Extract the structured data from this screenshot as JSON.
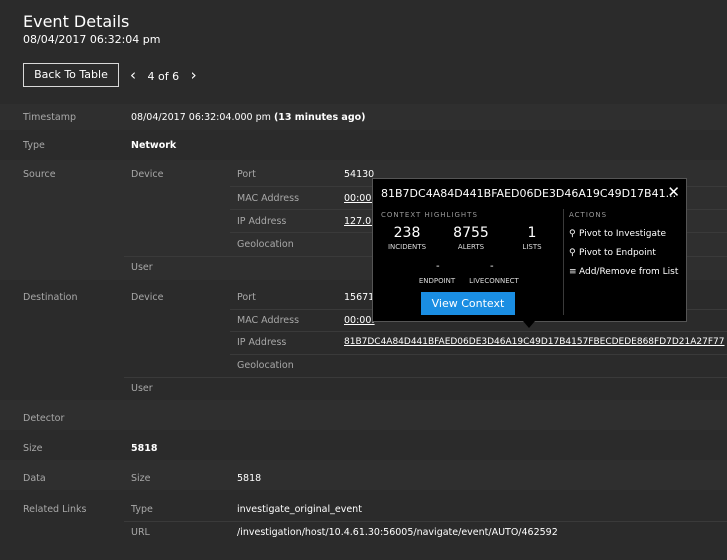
{
  "header": {
    "title": "Event Details",
    "timestamp": "08/04/2017 06:32:04 pm",
    "back_label": "Back To Table",
    "pager": "4 of 6"
  },
  "fields": {
    "timestamp": {
      "label": "Timestamp",
      "value": "08/04/2017 06:32:04.000 pm",
      "relative": "(13 minutes ago)"
    },
    "type": {
      "label": "Type",
      "value": "Network"
    },
    "source": {
      "label": "Source",
      "device": "Device",
      "port_label": "Port",
      "port": "54130",
      "mac_label": "MAC Address",
      "mac": "00:00:",
      "ip_label": "IP Address",
      "ip": "127.0.",
      "geo_label": "Geolocation",
      "user": "User"
    },
    "destination": {
      "label": "Destination",
      "device": "Device",
      "port_label": "Port",
      "port": "15671",
      "mac_label": "MAC Address",
      "mac": "00:00:",
      "ip_label": "IP Address",
      "ip": "81B7DC4A84D441BFAED06DE3D46A19C49D17B4157FBECDEDE868FD7D21A27F77",
      "geo_label": "Geolocation",
      "user": "User"
    },
    "detector": {
      "label": "Detector"
    },
    "size": {
      "label": "Size",
      "value": "5818"
    },
    "data": {
      "label": "Data",
      "size_label": "Size",
      "size": "5818"
    },
    "related": {
      "label": "Related Links",
      "type_label": "Type",
      "type": "investigate_original_event",
      "url_label": "URL",
      "url": "/investigation/host/10.4.61.30:56005/navigate/event/AUTO/462592"
    }
  },
  "popover": {
    "title": "81B7DC4A84D441BFAED06DE3D46A19C49D17B41...",
    "close": "✕",
    "context_title": "CONTEXT HIGHLIGHTS",
    "incidents": "238",
    "incidents_label": "INCIDENTS",
    "alerts": "8755",
    "alerts_label": "ALERTS",
    "lists": "1",
    "lists_label": "LISTS",
    "endpoint_dash": "-",
    "endpoint_label": "ENDPOINT",
    "liveconnect_dash": "-",
    "liveconnect_label": "LIVECONNECT",
    "view_button": "View Context",
    "actions_title": "ACTIONS",
    "action_investigate": "Pivot to Investigate",
    "action_endpoint": "Pivot to Endpoint",
    "action_list": "Add/Remove from List"
  }
}
